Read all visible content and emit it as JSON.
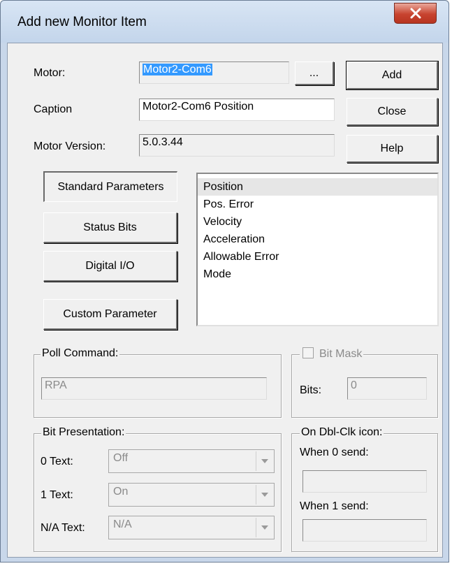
{
  "window": {
    "title": "Add new Monitor Item"
  },
  "form": {
    "motor": {
      "label": "Motor:",
      "value": "Motor2-Com6"
    },
    "browse_label": "...",
    "caption": {
      "label": "Caption",
      "value": "Motor2-Com6 Position"
    },
    "motor_version": {
      "label": "Motor Version:",
      "value": "5.0.3.44"
    }
  },
  "actions": {
    "add": "Add",
    "close": "Close",
    "help": "Help"
  },
  "categories": {
    "standard": "Standard Parameters",
    "status_bits": "Status Bits",
    "digital_io": "Digital I/O",
    "custom": "Custom Parameter"
  },
  "parameters": {
    "selected": "Position",
    "items": [
      "Position",
      "Pos. Error",
      "Velocity",
      "Acceleration",
      "Allowable Error",
      "Mode"
    ]
  },
  "poll_command": {
    "legend": "Poll Command:",
    "value": "RPA"
  },
  "bit_mask": {
    "legend": "Bit Mask",
    "checked": false,
    "bits_label": "Bits:",
    "bits_value": "0"
  },
  "bit_presentation": {
    "legend": "Bit Presentation:",
    "zero": {
      "label": "0 Text:",
      "value": "Off"
    },
    "one": {
      "label": "1 Text:",
      "value": "On"
    },
    "na": {
      "label": "N/A Text:",
      "value": "N/A"
    }
  },
  "dblclk": {
    "legend": "On Dbl-Clk icon:",
    "when0_label": "When 0 send:",
    "when0_value": "",
    "when1_label": "When 1 send:",
    "when1_value": ""
  },
  "colors": {
    "selection": "#3399ff",
    "close_button": "#c8432f",
    "dialog_bg": "#f0f0f0"
  },
  "icons": {
    "close": "close-x-icon",
    "dropdown": "chevron-down-icon",
    "checkbox": "checkbox-icon"
  }
}
